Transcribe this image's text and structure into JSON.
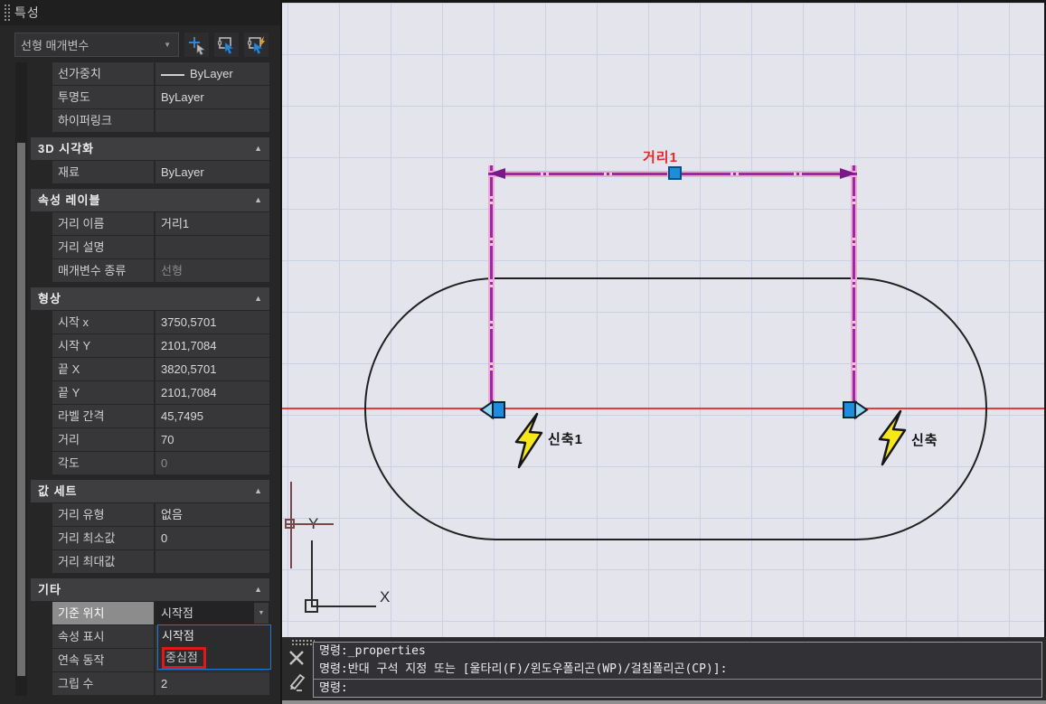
{
  "palette": {
    "title": "특성",
    "type_selector": {
      "value": "선형 매개변수",
      "caret": "▼"
    },
    "collapse_arrow": "▲",
    "combo_caret": "▼",
    "sections": [
      {
        "title": "",
        "rows": [
          {
            "label": "선가중치",
            "value": "ByLayer"
          },
          {
            "label": "투명도",
            "value": "ByLayer"
          },
          {
            "label": "하이퍼링크",
            "value": ""
          }
        ]
      },
      {
        "title": "3D 시각화",
        "rows": [
          {
            "label": "재료",
            "value": "ByLayer"
          }
        ]
      },
      {
        "title": "속성 레이블",
        "rows": [
          {
            "label": "거리 이름",
            "value": "거리1"
          },
          {
            "label": "거리 설명",
            "value": ""
          },
          {
            "label": "매개변수 종류",
            "value": "선형"
          }
        ]
      },
      {
        "title": "형상",
        "rows": [
          {
            "label": "시작 x",
            "value": "3750,5701"
          },
          {
            "label": "시작 Y",
            "value": "2101,7084"
          },
          {
            "label": "끝 X",
            "value": "3820,5701"
          },
          {
            "label": "끝 Y",
            "value": "2101,7084"
          },
          {
            "label": "라벨 간격",
            "value": "45,7495"
          },
          {
            "label": "거리",
            "value": "70"
          },
          {
            "label": "각도",
            "value": "0"
          }
        ]
      },
      {
        "title": "값 세트",
        "rows": [
          {
            "label": "거리 유형",
            "value": "없음"
          },
          {
            "label": "거리 최소값",
            "value": "0"
          },
          {
            "label": "거리 최대값",
            "value": ""
          }
        ]
      },
      {
        "title": "기타",
        "rows": [
          {
            "label": "기준 위치",
            "value": "시작점"
          },
          {
            "label": "속성 표시",
            "value": ""
          },
          {
            "label": "연속 동작",
            "value": ""
          },
          {
            "label": "그립 수",
            "value": "2"
          }
        ]
      }
    ],
    "base_position_dropdown": {
      "options": [
        "시작점",
        "중심점"
      ],
      "highlighted": "중심점",
      "highlight_color": "#e01818",
      "border_color": "#1f78d0"
    }
  },
  "canvas": {
    "dimension_label": "거리1",
    "stretch_action_1": "신축1",
    "stretch_action_2": "신축",
    "axis_x": "X",
    "axis_y": "Y",
    "colors": {
      "background": "#e4e5ec",
      "grid": "#cbd1e5",
      "crosshair_line": "#ee3838",
      "dimension_core": "#9c27a8",
      "dimension_glow": "#efacd2",
      "grip_blue": "#1f8ce0",
      "bolt_yellow": "#f6e71b",
      "label_red": "#e02828"
    }
  },
  "command": {
    "line1": "명령:_properties",
    "line2": "명령:반대 구석 지정 또는 [울타리(F)/윈도우폴리곤(WP)/걸침폴리곤(CP)]:",
    "line3": "명령:"
  }
}
